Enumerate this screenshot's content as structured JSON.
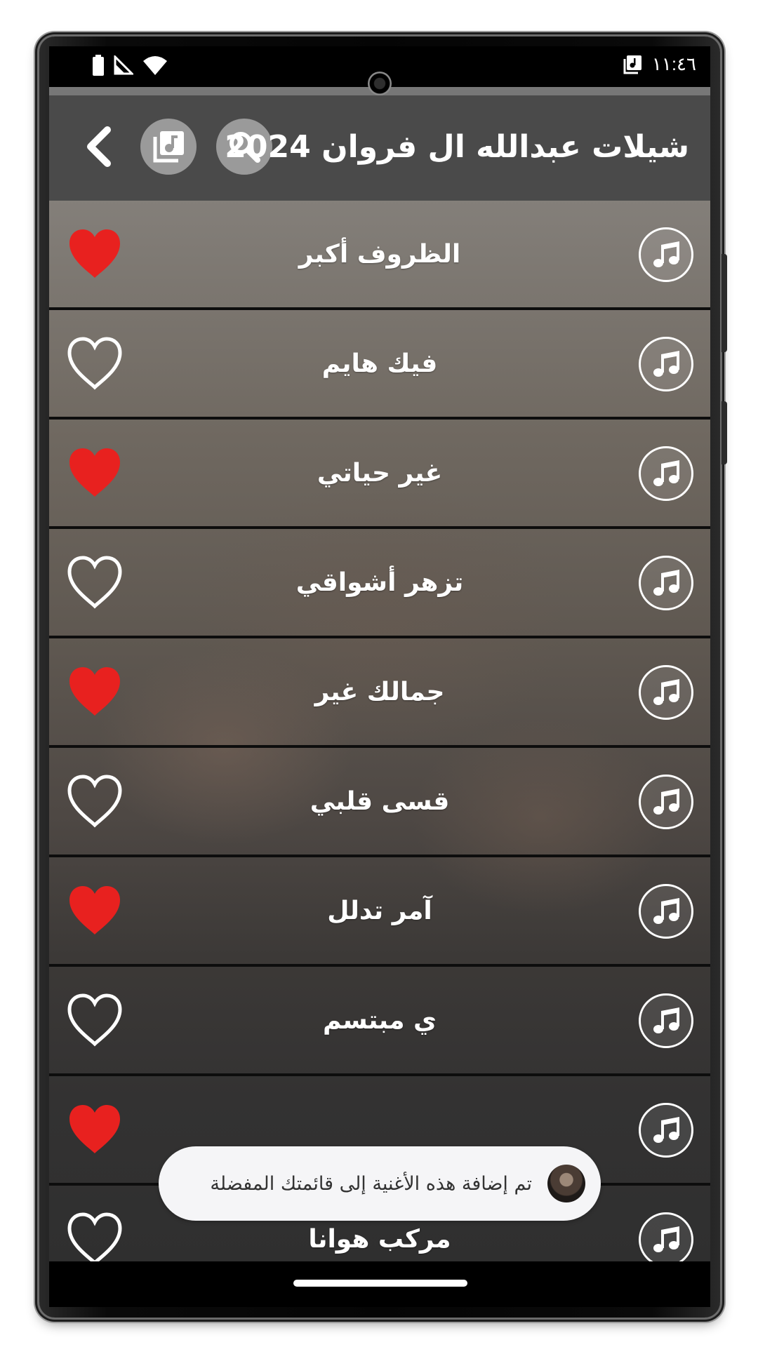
{
  "status_bar": {
    "time": "١١:٤٦",
    "icons": [
      "battery-icon",
      "signal-icon",
      "wifi-icon",
      "music-app-notification-icon"
    ]
  },
  "header": {
    "title": "شيلات عبدالله ال فروان 2024",
    "buttons": [
      "search-icon",
      "music-library-icon",
      "back-chevron-icon"
    ],
    "background": "#484848"
  },
  "songs": [
    {
      "title": "الظروف أكبر",
      "favorite": true
    },
    {
      "title": "فيك هايم",
      "favorite": false
    },
    {
      "title": "غير حياتي",
      "favorite": true
    },
    {
      "title": "تزهر أشواقي",
      "favorite": false
    },
    {
      "title": "جمالك غير",
      "favorite": true
    },
    {
      "title": "قسى قلبي",
      "favorite": false
    },
    {
      "title": "آمر تدلل",
      "favorite": true
    },
    {
      "title": "ي مبتسم",
      "favorite": false
    },
    {
      "title": "",
      "favorite": true
    },
    {
      "title": "مركب هوانا",
      "favorite": false
    }
  ],
  "toast": {
    "message": "تم إضافة هذه الأغنية إلى قائمتك المفضلة"
  },
  "colors": {
    "heart_filled": "#e8211f",
    "heart_outline": "#ffffff",
    "separator": "#0d0d0d"
  }
}
